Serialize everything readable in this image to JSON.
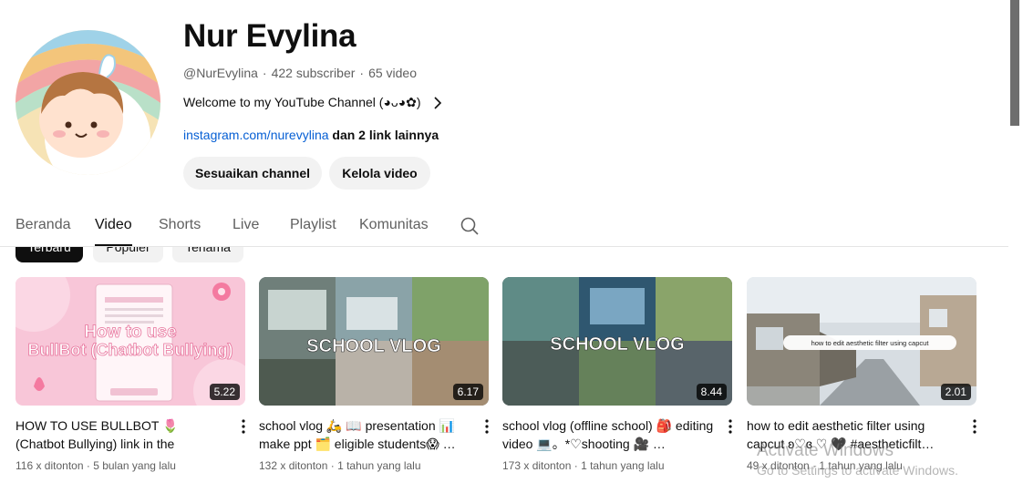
{
  "channel": {
    "name": "Nur Evylina",
    "handle": "@NurEvylina",
    "subscribers": "422 subscriber",
    "video_count": "65 video",
    "separator": "·",
    "description": "Welcome to my YouTube Channel (◕ᴗ◕✿)",
    "link_text": "instagram.com/nurevylina",
    "more_links": "dan 2 link lainnya",
    "customize_button": "Sesuaikan channel",
    "manage_button": "Kelola video"
  },
  "tabs": [
    "Beranda",
    "Video",
    "Shorts",
    "Live",
    "Playlist",
    "Komunitas"
  ],
  "active_tab": "Video",
  "filters": [
    "Terbaru",
    "Populer",
    "Terlama"
  ],
  "active_filter": "Terbaru",
  "videos": [
    {
      "title": "HOW TO USE BULLBOT 🌷 (Chatbot Bullying) link in the description 💗 …",
      "views": "116 x ditonton",
      "age": "5 bulan yang lalu",
      "duration": "5.22",
      "thumb_text": "How to use BullBot (Chatbot Bullying)"
    },
    {
      "title": "school vlog 🛵 📖 presentation 📊 make ppt 🗂️ eligible students😱 …",
      "views": "132 x ditonton",
      "age": "1 tahun yang lalu",
      "duration": "6.17",
      "thumb_text": "SCHOOL VLOG"
    },
    {
      "title": "school vlog (offline school) 🎒 editing video 💻。*♡shooting 🎥 …",
      "views": "173 x ditonton",
      "age": "1 tahun yang lalu",
      "duration": "8.44",
      "thumb_text": "SCHOOL VLOG"
    },
    {
      "title": "how to edit aesthetic filter using capcut ʚ♡ɞ ♡ 🖤 #aestheticfilt…",
      "views": "49 x ditonton",
      "age": "1 tahun yang lalu",
      "duration": "2.01",
      "thumb_text": "how to edit aesthetic filter using capcut"
    }
  ],
  "watermark": {
    "line1": "Activate Windows",
    "line2": "Go to Settings to activate Windows."
  },
  "icons": {
    "search": "search-icon",
    "more": "more-vert-icon",
    "chevron": "chevron-right-icon"
  },
  "colors": {
    "link": "#065fd4",
    "chip_active": "#0f0f0f",
    "chip": "#f2f2f2"
  }
}
